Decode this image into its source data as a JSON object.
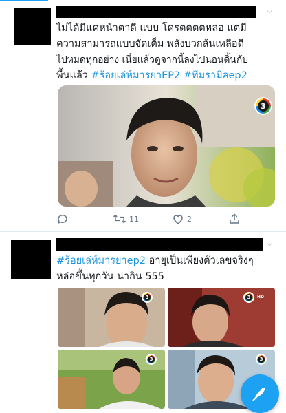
{
  "tweet1": {
    "text_line1": "ไม่ได้มีแค่หน้าตาดี แบบ โครตตตตหล่อ แต่มี",
    "text_line2": "ความสามารถแบบจัดเต็ม พลังบวกล้นเหลือดี",
    "text_line3": "ไปหมดทุกอย่าง เนี่ยแล้วดูจากนี้ลงไปนอนดิ้นกับ",
    "text_line4_prefix": "พื้นแล้ว ",
    "hashtag1": "#ร้อยเล่ห์มารยาEP2",
    "hashtag2": "#ทีมรามิลep2",
    "retweet_count": "11",
    "like_count": "2",
    "channel_logo_text": "3"
  },
  "tweet2": {
    "hashtag": "#ร้อยเล่ห์มารยาep2",
    "text_line1_suffix": "  อายุเป็นเพียงตัวเลขจริงๆ",
    "text_line2": "หล่อขึ้นทุกวัน น่ากิน 555",
    "photo_badge_text": "3",
    "hd_label": "HD"
  },
  "icons": {
    "reply": "reply-icon",
    "retweet": "retweet-icon",
    "like": "heart-icon",
    "share": "share-icon",
    "caret": "chevron-down-icon",
    "compose": "compose-feather-icon"
  },
  "colors": {
    "accent": "#1da1f2",
    "hashtag": "#1b95e0",
    "muted": "#657786"
  }
}
